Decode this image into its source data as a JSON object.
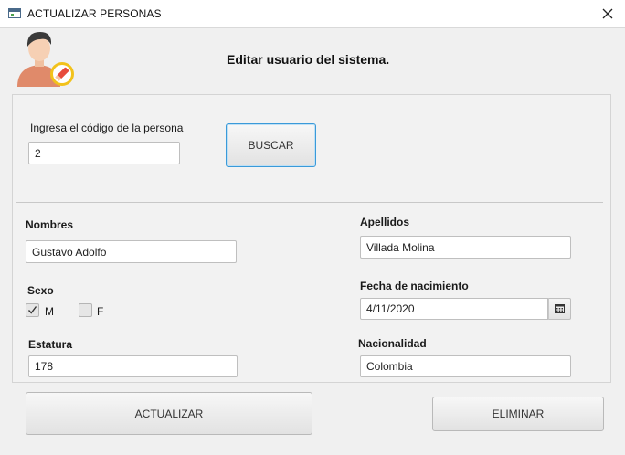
{
  "window": {
    "title": "ACTUALIZAR PERSONAS",
    "icon": "app-window-icon",
    "close_icon": "close-icon"
  },
  "header": {
    "title": "Editar usuario del sistema.",
    "avatar_icon": "user-edit-icon"
  },
  "search": {
    "label": "Ingresa el código de la persona",
    "value": "2",
    "button_label": "BUSCAR"
  },
  "form": {
    "nombres": {
      "label": "Nombres",
      "value": "Gustavo Adolfo"
    },
    "apellidos": {
      "label": "Apellidos",
      "value": "Villada Molina"
    },
    "sexo": {
      "label": "Sexo",
      "options": [
        {
          "label": "M",
          "checked": true
        },
        {
          "label": "F",
          "checked": false
        }
      ]
    },
    "fecha": {
      "label": "Fecha de nacimiento",
      "value": "4/11/2020",
      "picker_icon": "calendar-icon"
    },
    "estatura": {
      "label": "Estatura",
      "value": "178"
    },
    "nacionalidad": {
      "label": "Nacionalidad",
      "value": "Colombia"
    }
  },
  "actions": {
    "update_label": "ACTUALIZAR",
    "delete_label": "ELIMINAR"
  },
  "colors": {
    "focus_border": "#3a9ad9",
    "badge_yellow": "#f2c21b",
    "badge_red": "#e74c3c"
  }
}
